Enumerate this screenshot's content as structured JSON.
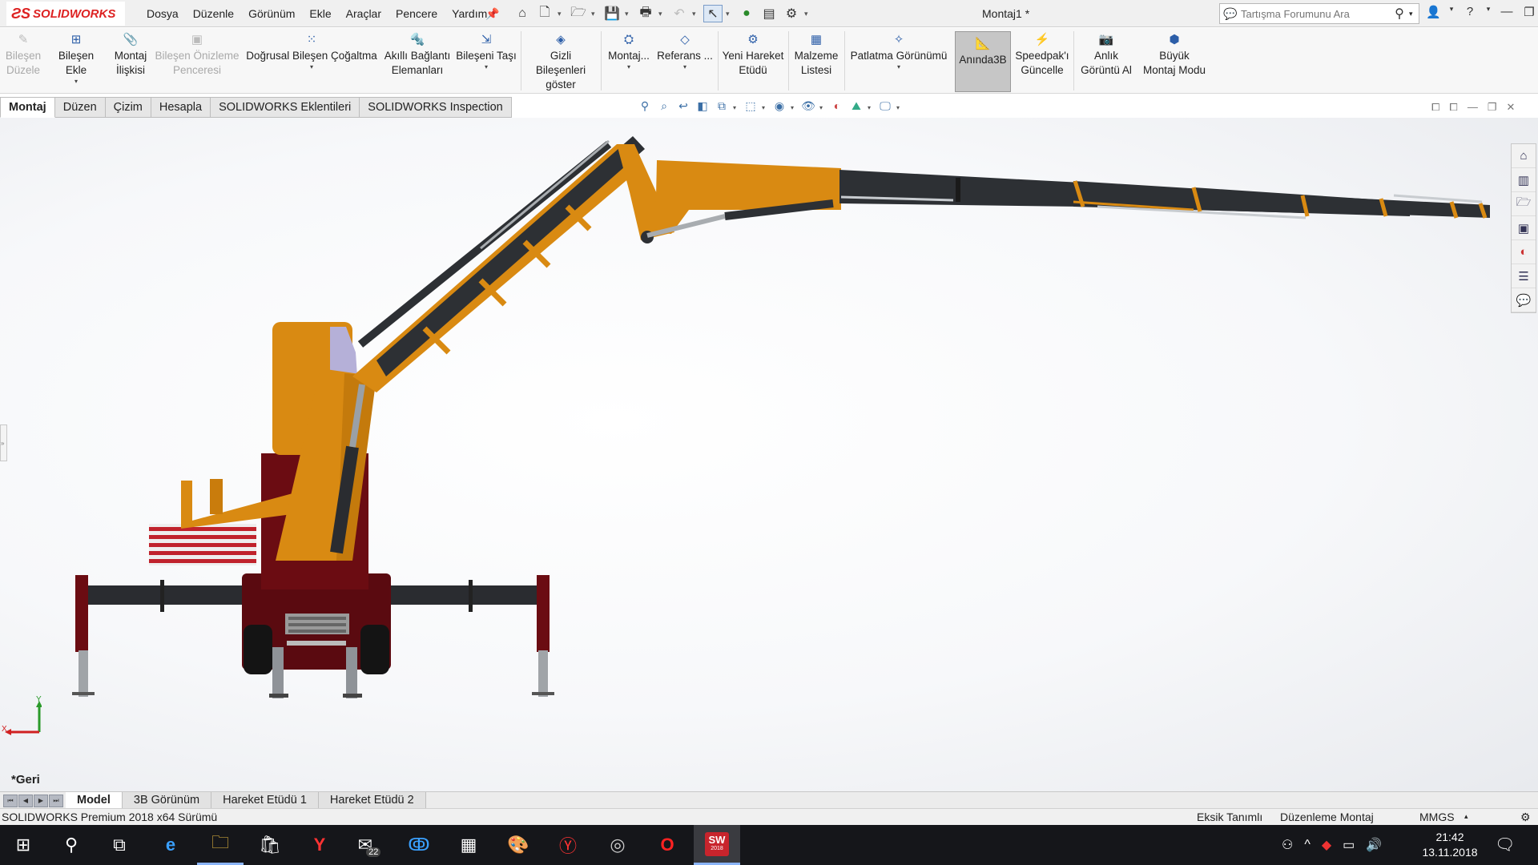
{
  "app": {
    "logo": "SOLIDWORKS",
    "menu": [
      "Dosya",
      "Düzenle",
      "Görünüm",
      "Ekle",
      "Araçlar",
      "Pencere",
      "Yardım"
    ],
    "document_title": "Montaj1 *",
    "search_placeholder": "Tartışma Forumunu Ara"
  },
  "ribbon": {
    "bilesen_duzele": [
      "Bileşen",
      "Düzele"
    ],
    "bilesen_ekle": "Bileşen Ekle",
    "montaj_iliskisi": [
      "Montaj",
      "İlişkisi"
    ],
    "bilesen_onizleme": [
      "Bileşen Önizleme",
      "Penceresi"
    ],
    "dogrusal": "Doğrusal Bileşen Çoğaltma",
    "akilli_baglanti": [
      "Akıllı Bağlantı",
      "Elemanları"
    ],
    "bileseni_tasi": "Bileşeni Taşı",
    "gizli_bilesenler": [
      "Gizli Bileşenleri",
      "göster"
    ],
    "montaj_dd": "Montaj...",
    "referans": "Referans ...",
    "yeni_hareket": [
      "Yeni Hareket",
      "Etüdü"
    ],
    "malzeme": [
      "Malzeme",
      "Listesi"
    ],
    "patlatma": "Patlatma Görünümü",
    "aninda3b": "Anında3B",
    "speedpak": [
      "Speedpak'ı",
      "Güncelle"
    ],
    "anlik": [
      "Anlık",
      "Görüntü Al"
    ],
    "buyuk_montaj": [
      "Büyük",
      "Montaj Modu"
    ]
  },
  "tabs": [
    "Montaj",
    "Düzen",
    "Çizim",
    "Hesapla",
    "SOLIDWORKS Eklentileri",
    "SOLIDWORKS Inspection"
  ],
  "active_tab": "Montaj",
  "viewport": {
    "back_label": "*Geri",
    "triad": {
      "x": "X",
      "y": "Y"
    }
  },
  "bottom_tabs": [
    "Model",
    "3B Görünüm",
    "Hareket Etüdü 1",
    "Hareket Etüdü 2"
  ],
  "status": {
    "version": "SOLIDWORKS Premium 2018 x64 Sürümü",
    "definition": "Eksik Tanımlı",
    "mode": "Düzenleme Montaj",
    "units": "MMGS"
  },
  "taskbar": {
    "mail_badge": "22",
    "sw_label": "SW",
    "sw_year": "2018",
    "time": "21:42",
    "date": "13.11.2018"
  },
  "colors": {
    "boom_orange": "#d98a12",
    "boom_black": "#2d3034",
    "truck_red": "#6b0c12",
    "accent_blue": "#2c5ea8"
  }
}
